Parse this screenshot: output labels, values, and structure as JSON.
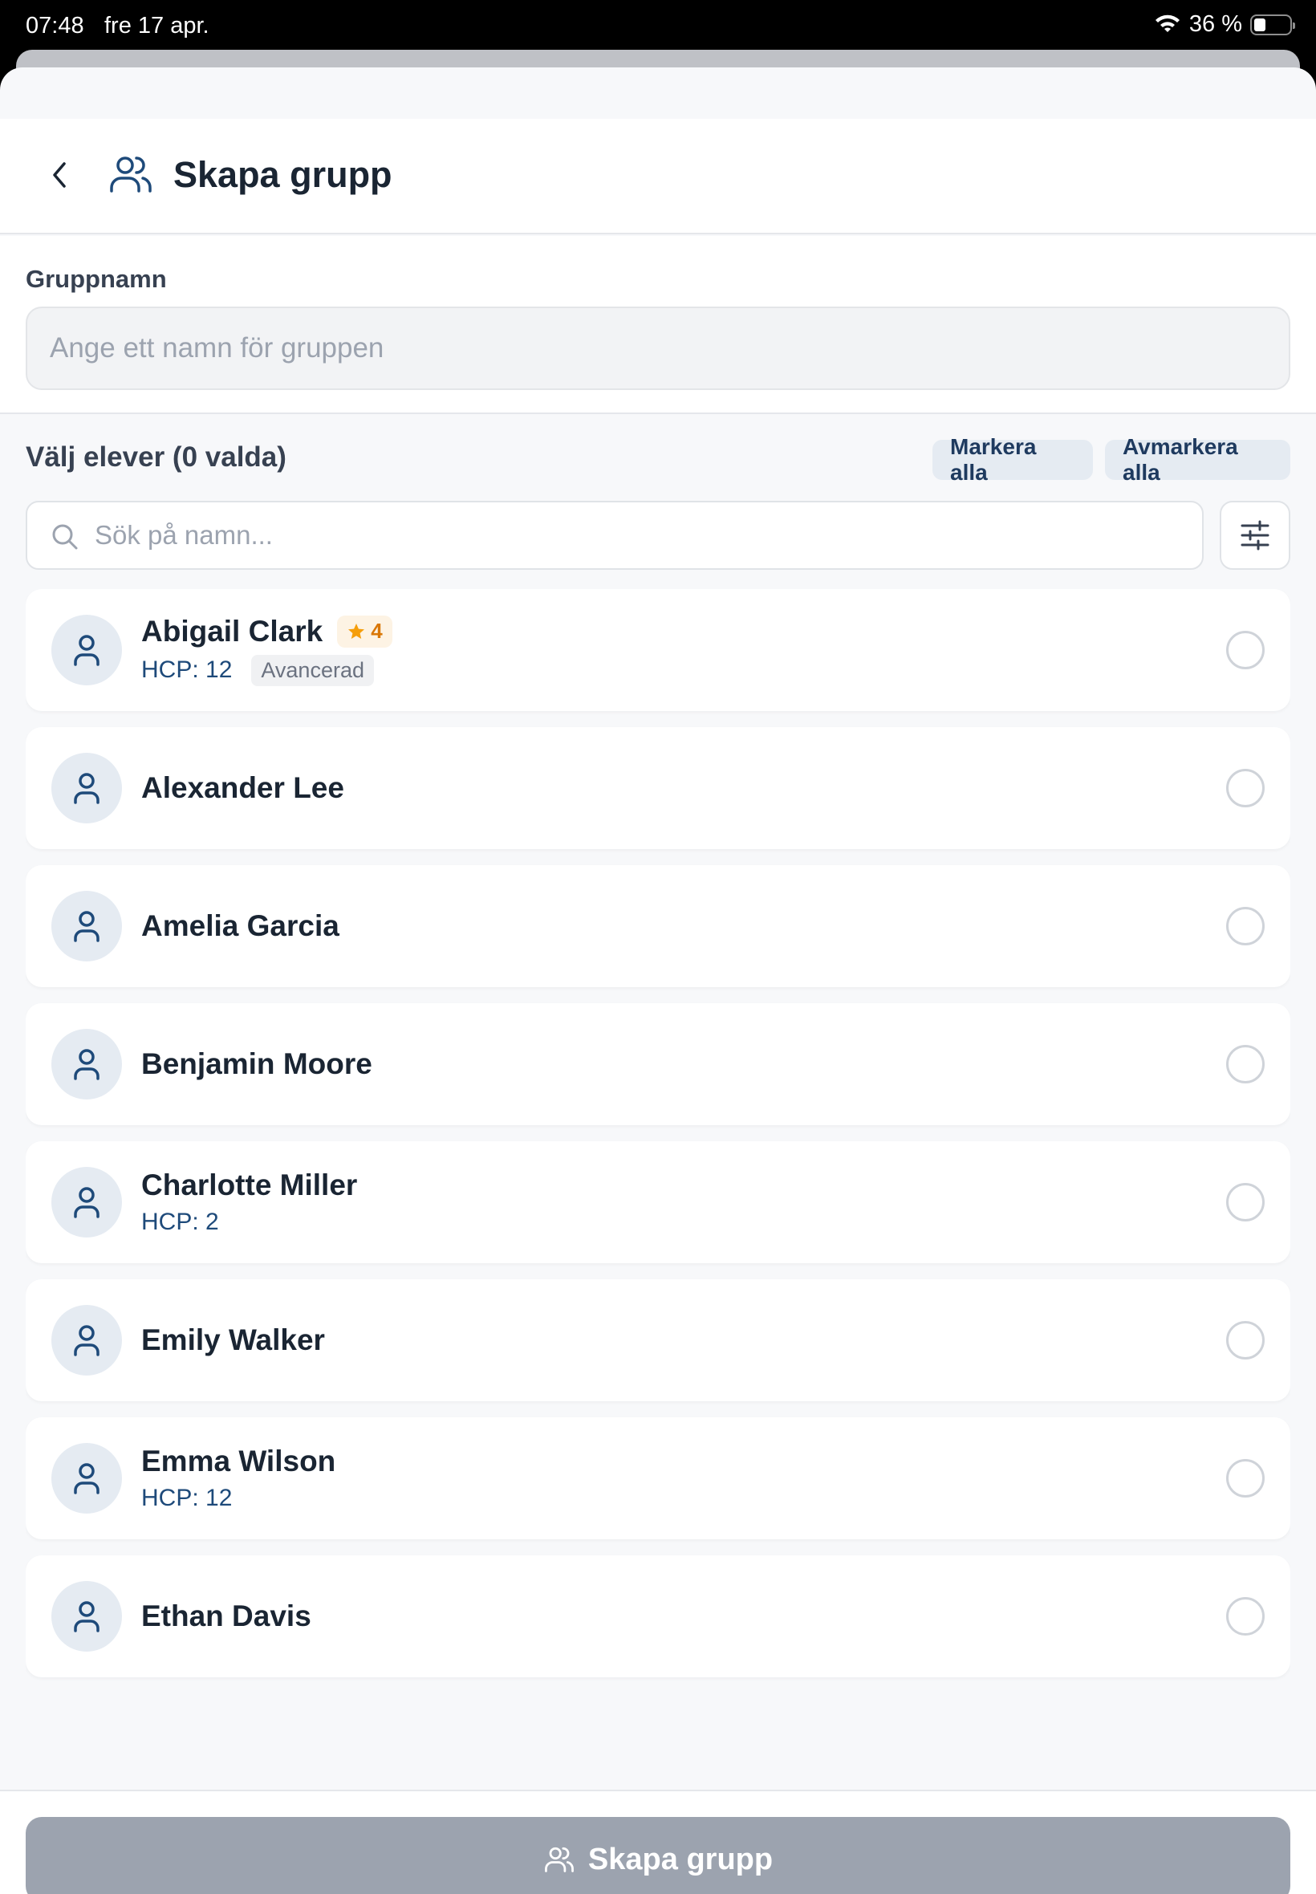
{
  "status_bar": {
    "time": "07:48",
    "date": "fre 17 apr.",
    "battery": "36 %"
  },
  "header": {
    "title": "Skapa grupp"
  },
  "group_name": {
    "label": "Gruppnamn",
    "value": "",
    "placeholder": "Ange ett namn för gruppen"
  },
  "select": {
    "heading": "Välj elever (0 valda)",
    "mark_all": "Markera alla",
    "unmark_all": "Avmarkera alla"
  },
  "search": {
    "value": "",
    "placeholder": "Sök på namn..."
  },
  "students": [
    {
      "name": "Abigail Clark",
      "rating": "4",
      "hcp": "HCP: 12",
      "level": "Avancerad"
    },
    {
      "name": "Alexander Lee"
    },
    {
      "name": "Amelia Garcia"
    },
    {
      "name": "Benjamin Moore"
    },
    {
      "name": "Charlotte Miller",
      "hcp": "HCP: 2"
    },
    {
      "name": "Emily Walker"
    },
    {
      "name": "Emma Wilson",
      "hcp": "HCP: 12"
    },
    {
      "name": "Ethan Davis"
    }
  ],
  "footer": {
    "create_label": "Skapa grupp"
  },
  "colors": {
    "primary_text": "#1a2533",
    "accent_blue": "#1e4a7a",
    "disabled_button": "#9ca3af",
    "star": "#f59e0b"
  },
  "icons": {
    "back": "chevron-left-icon",
    "title": "users-icon",
    "search": "search-icon",
    "filter": "sliders-icon",
    "avatar": "user-icon",
    "rating": "star-icon"
  }
}
